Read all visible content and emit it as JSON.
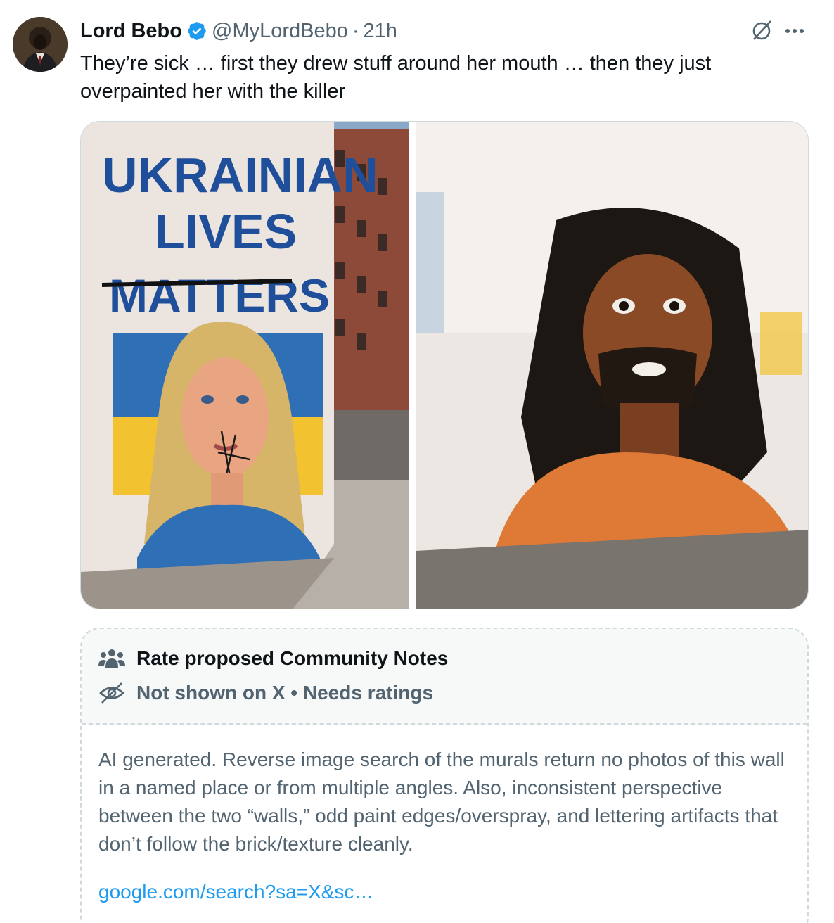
{
  "tweet": {
    "display_name": "Lord Bebo",
    "handle": "@MyLordBebo",
    "separator": "·",
    "time": "21h",
    "text": "They’re sick … first they drew stuff around her mouth … then they just overpainted her with the killer"
  },
  "media": {
    "left_mural": {
      "line1": "UKRAINIAN",
      "line2": "LIVES",
      "line3": "MATTERS"
    }
  },
  "community_note": {
    "title": "Rate proposed Community Notes",
    "status": "Not shown on X • Needs ratings",
    "body": "AI generated. Reverse image search of the murals return no photos of this wall in a named place or from multiple angles. Also, inconsistent perspective between the two “walls,” odd paint edges/overspray, and lettering artifacts that don’t follow the brick/texture cleanly.",
    "link": "google.com/search?sa=X&sc…"
  },
  "colors": {
    "verified_blue": "#1d9bf0",
    "link_blue": "#1d9bf0",
    "text_primary": "#0f1419",
    "text_secondary": "#536471",
    "ukraine_blue": "#2f6fb6",
    "ukraine_yellow": "#f2c230"
  },
  "icons": [
    "verified-badge-icon",
    "grok-icon",
    "more-icon",
    "community-icon",
    "eye-slash-icon"
  ]
}
